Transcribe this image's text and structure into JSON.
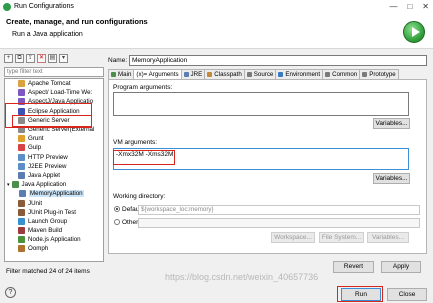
{
  "window": {
    "title": "Run Configurations",
    "controls": [
      "—",
      "□",
      "✕"
    ]
  },
  "header": {
    "title": "Create, manage, and run configurations",
    "subtitle": "Run a Java application"
  },
  "left": {
    "toolbar": [
      "new-icon",
      "duplicate-icon",
      "export-icon",
      "delete-icon",
      "collapse-icon",
      "filter-icon"
    ],
    "filter_placeholder": "type filter text",
    "tree": [
      {
        "label": "Apache Tomcat",
        "color": "#d9a440",
        "indent": "child"
      },
      {
        "label": "Aspect/ Load-Time We:",
        "color": "#7e57c2",
        "indent": "child"
      },
      {
        "label": "AspectJ/Java Applicatio",
        "color": "#7e57c2",
        "indent": "child"
      },
      {
        "label": "Eclipse Application",
        "color": "#3f51b5",
        "indent": "child"
      },
      {
        "label": "Generic Server",
        "color": "#8a8a8a",
        "indent": "child"
      },
      {
        "label": "Generic Server(External",
        "color": "#8a8a8a",
        "indent": "child"
      },
      {
        "label": "Grunt",
        "color": "#e0a02c",
        "indent": "child"
      },
      {
        "label": "Gulp",
        "color": "#d84343",
        "indent": "child"
      },
      {
        "label": "HTTP Preview",
        "color": "#5d8fc7",
        "indent": "child"
      },
      {
        "label": "J2EE Preview",
        "color": "#5d8fc7",
        "indent": "child"
      },
      {
        "label": "Java Applet",
        "color": "#5b7db1",
        "indent": "child"
      },
      {
        "label": "Java Application",
        "color": "#4b8f4b",
        "indent": "group"
      },
      {
        "label": "MemoryApplication",
        "color": "#5b7db1",
        "indent": "sub",
        "selected": true
      },
      {
        "label": "JUnit",
        "color": "#8a5a3a",
        "indent": "child"
      },
      {
        "label": "JUnit Plug-in Test",
        "color": "#8a5a3a",
        "indent": "child"
      },
      {
        "label": "Launch Group",
        "color": "#3a8fd0",
        "indent": "child"
      },
      {
        "label": "Maven Build",
        "color": "#9b3b3b",
        "indent": "child"
      },
      {
        "label": "Node.js Application",
        "color": "#4c8f3c",
        "indent": "child"
      },
      {
        "label": "Oomph",
        "color": "#b07030",
        "indent": "child"
      }
    ],
    "status": "Filter matched 24 of 24 items"
  },
  "right": {
    "name_label": "Name:",
    "name_value": "MemoryApplication",
    "tabs": [
      {
        "label": "Main",
        "color": "#4b8f4b",
        "active": false
      },
      {
        "label": "(x)= Arguments",
        "color": "#ffffff",
        "active": true
      },
      {
        "label": "JRE",
        "color": "#5b7db1",
        "active": false
      },
      {
        "label": "Classpath",
        "color": "#c28a3a",
        "active": false
      },
      {
        "label": "Source",
        "color": "#7a7a7a",
        "active": false
      },
      {
        "label": "Environment",
        "color": "#3a7ac0",
        "active": false
      },
      {
        "label": "Common",
        "color": "#7a7a7a",
        "active": false
      },
      {
        "label": "Prototype",
        "color": "#7a7a7a",
        "active": false
      }
    ],
    "program_args_label": "Program arguments:",
    "program_args_value": "",
    "variables_label": "Variables...",
    "vm_args_label": "VM arguments:",
    "vm_args_value": "-Xmx32M -Xms32M",
    "working_dir_label": "Working directory:",
    "default_label": "Default:",
    "default_value": "${workspace_loc:memory}",
    "other_label": "Other:",
    "workspace_btn": "Workspace...",
    "filesystem_btn": "File System...",
    "revert_btn": "Revert",
    "apply_btn": "Apply"
  },
  "footer": {
    "run_btn": "Run",
    "close_btn": "Close",
    "help": "?"
  },
  "watermark": "https://blog.csdn.net/weixin_40657736"
}
